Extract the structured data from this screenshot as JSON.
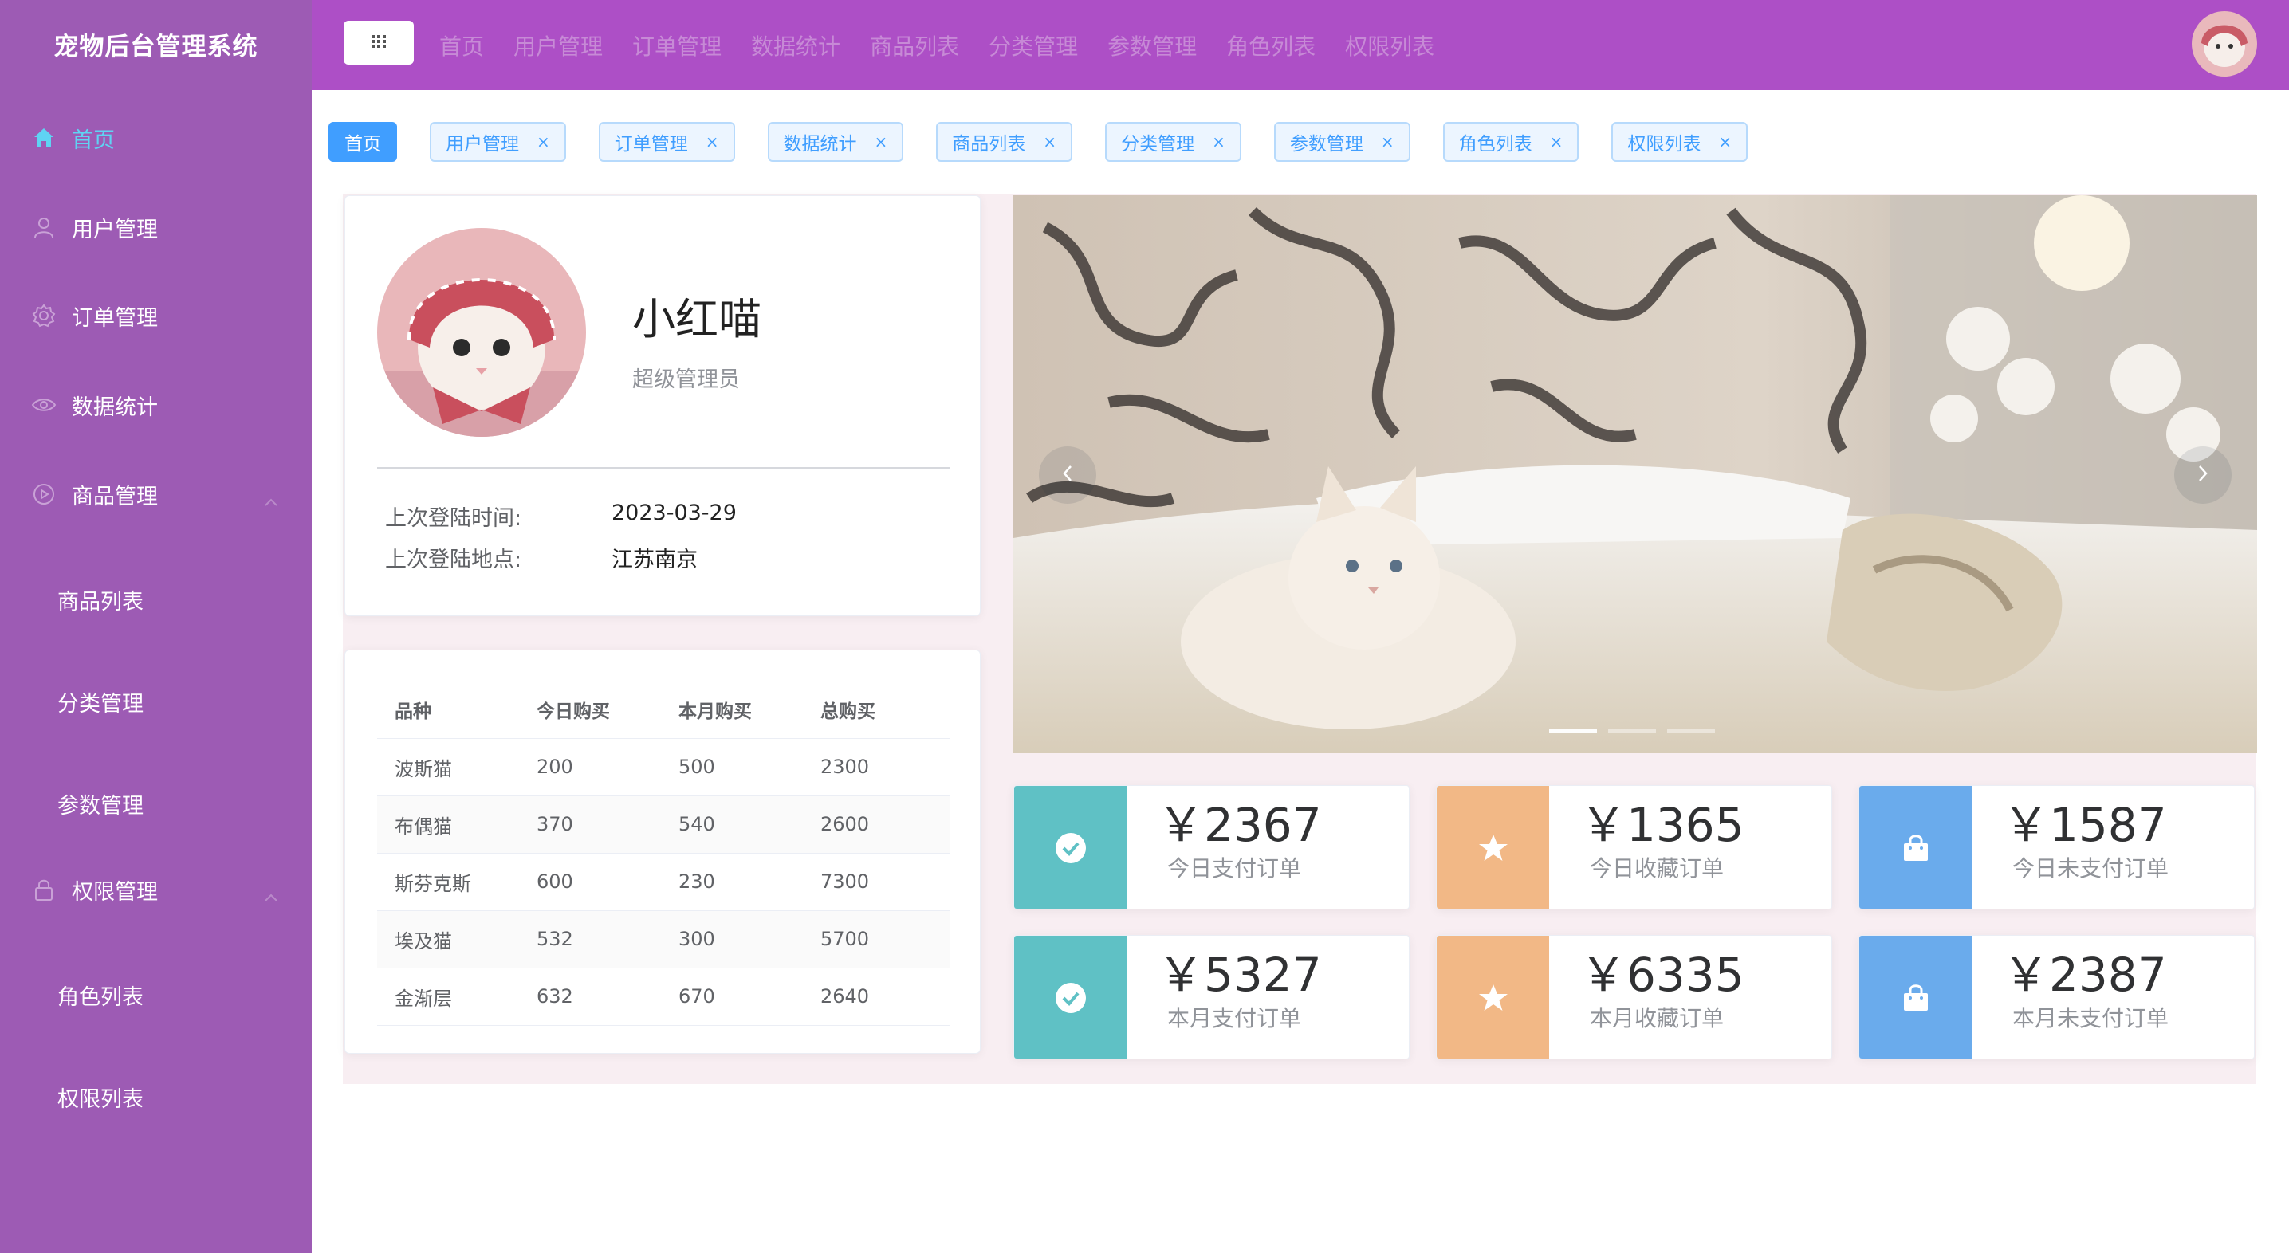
{
  "app": {
    "title": "宠物后台管理系统"
  },
  "sidebar": {
    "items": [
      {
        "label": "首页",
        "icon": "home-icon"
      },
      {
        "label": "用户管理",
        "icon": "user-icon"
      },
      {
        "label": "订单管理",
        "icon": "gear-icon"
      },
      {
        "label": "数据统计",
        "icon": "eye-icon"
      },
      {
        "label": "商品管理",
        "icon": "play-circle-icon"
      },
      {
        "label": "权限管理",
        "icon": "lock-icon"
      }
    ],
    "sub_goods": [
      "商品列表",
      "分类管理",
      "参数管理"
    ],
    "sub_perm": [
      "角色列表",
      "权限列表"
    ],
    "active_color": "#5fd3f3",
    "bg_color": "#9d5bb4"
  },
  "header": {
    "nav": [
      "首页",
      "用户管理",
      "订单管理",
      "数据统计",
      "商品列表",
      "分类管理",
      "参数管理",
      "角色列表",
      "权限列表"
    ],
    "bg_color": "#ad4fc6"
  },
  "tags": {
    "active": "首页",
    "items": [
      "用户管理",
      "订单管理",
      "数据统计",
      "商品列表",
      "分类管理",
      "参数管理",
      "角色列表",
      "权限列表"
    ],
    "close": "×"
  },
  "profile": {
    "name": "小红喵",
    "role": "超级管理员",
    "last_login_time_label": "上次登陆时间:",
    "last_login_time": "2023-03-29",
    "last_login_place_label": "上次登陆地点:",
    "last_login_place": "江苏南京"
  },
  "table": {
    "headers": [
      "品种",
      "今日购买",
      "本月购买",
      "总购买"
    ],
    "rows": [
      [
        "波斯猫",
        "200",
        "500",
        "2300"
      ],
      [
        "布偶猫",
        "370",
        "540",
        "2600"
      ],
      [
        "斯芬克斯",
        "600",
        "230",
        "7300"
      ],
      [
        "埃及猫",
        "532",
        "300",
        "5700"
      ],
      [
        "金渐层",
        "632",
        "670",
        "2640"
      ]
    ]
  },
  "carousel": {
    "indicator_count": 3,
    "active_index": 0
  },
  "stats": [
    {
      "value": "￥2367",
      "label": "今日支付订单",
      "color": "#5fc1c5",
      "icon": "check-circle-icon"
    },
    {
      "value": "￥1365",
      "label": "今日收藏订单",
      "color": "#f2b886",
      "icon": "star-icon"
    },
    {
      "value": "￥1587",
      "label": "今日未支付订单",
      "color": "#6aabec",
      "icon": "shopping-bag-icon"
    },
    {
      "value": "￥5327",
      "label": "本月支付订单",
      "color": "#5fc1c5",
      "icon": "check-circle-icon"
    },
    {
      "value": "￥6335",
      "label": "本月收藏订单",
      "color": "#f2b886",
      "icon": "star-icon"
    },
    {
      "value": "￥2387",
      "label": "本月未支付订单",
      "color": "#6aabec",
      "icon": "shopping-bag-icon"
    }
  ]
}
